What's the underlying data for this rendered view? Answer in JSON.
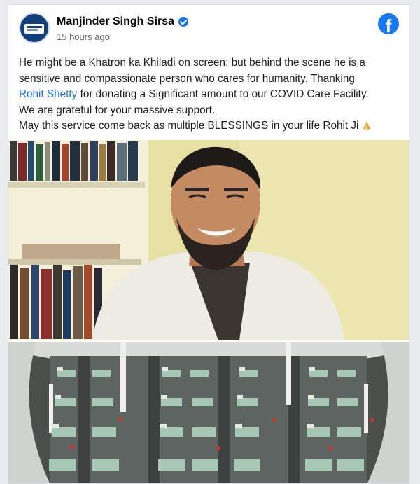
{
  "post": {
    "author": "Manjinder Singh Sirsa",
    "time": "15 hours ago",
    "verified": true,
    "text": {
      "line1": "He might be a Khatron ka Khiladi on screen; but behind the scene he is a",
      "line2": "sensitive and compassionate person who cares for humanity. Thanking",
      "link": "Rohit Shetty",
      "line3_rest": " for donating a Significant amount to our COVID Care Facility.",
      "line4": "We are grateful for your massive support.",
      "line5": "May this service come back as multiple BLESSINGS in your life Rohit Ji"
    }
  },
  "brand": {
    "logo_letter": "f",
    "logo_color": "#1877f2"
  },
  "icons": {
    "avatar": "avatar",
    "verified": "verified-badge-icon",
    "logo": "facebook-logo-icon",
    "emoji": "folded-hands-icon"
  }
}
